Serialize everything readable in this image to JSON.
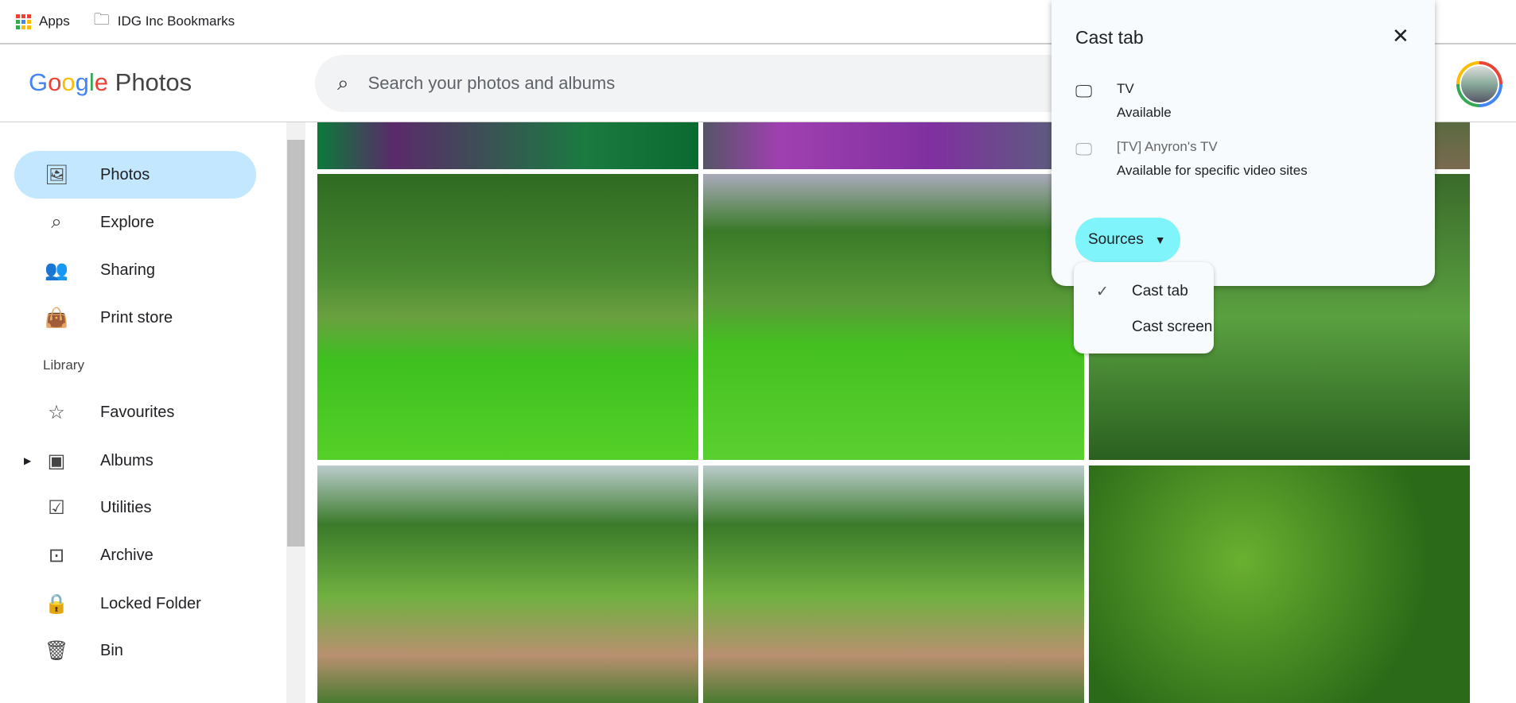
{
  "bookmarks": [
    {
      "label": "Apps",
      "icon": "apps-grid-icon"
    },
    {
      "label": "IDG Inc Bookmarks",
      "icon": "managed-folder-icon"
    }
  ],
  "header": {
    "logo": {
      "google": "Google",
      "product": "Photos"
    },
    "search_placeholder": "Search your photos and albums"
  },
  "sidebar": {
    "items": [
      {
        "label": "Photos",
        "icon": "photo-icon",
        "selected": true
      },
      {
        "label": "Explore",
        "icon": "search-icon"
      },
      {
        "label": "Sharing",
        "icon": "people-icon"
      },
      {
        "label": "Print store",
        "icon": "shopping-bag-icon"
      }
    ],
    "library_label": "Library",
    "library_items": [
      {
        "label": "Favourites",
        "icon": "star-icon"
      },
      {
        "label": "Albums",
        "icon": "album-icon"
      },
      {
        "label": "Utilities",
        "icon": "checklist-icon"
      },
      {
        "label": "Archive",
        "icon": "archive-icon"
      },
      {
        "label": "Locked Folder",
        "icon": "lock-icon"
      },
      {
        "label": "Bin",
        "icon": "trash-icon"
      }
    ]
  },
  "cast": {
    "title": "Cast tab",
    "devices": [
      {
        "name": "TV",
        "status": "Available",
        "enabled": true
      },
      {
        "name": "[TV] Anyron's TV",
        "status": "Available for specific video sites",
        "enabled": false
      }
    ],
    "sources_label": "Sources",
    "menu": [
      {
        "label": "Cast tab",
        "checked": true
      },
      {
        "label": "Cast screen",
        "checked": false
      }
    ]
  },
  "colors": {
    "selected_nav": "#c2e7ff",
    "sources_button": "#80f4fb",
    "popup_bg": "#f7fbfd"
  }
}
